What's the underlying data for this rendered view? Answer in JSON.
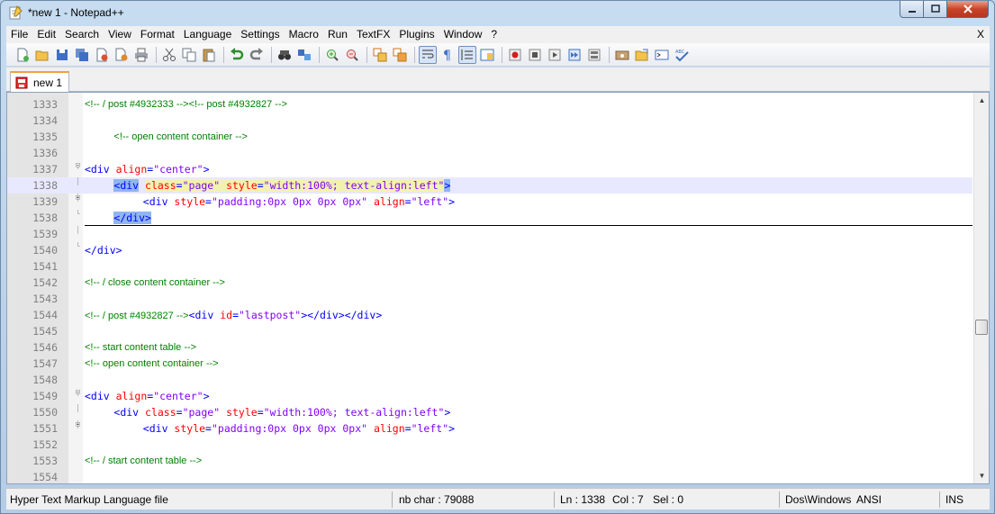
{
  "window": {
    "title": "*new 1 - Notepad++"
  },
  "menu": {
    "items": [
      "File",
      "Edit",
      "Search",
      "View",
      "Format",
      "Language",
      "Settings",
      "Macro",
      "Run",
      "TextFX",
      "Plugins",
      "Window",
      "?"
    ],
    "close_label": "X"
  },
  "tabs": [
    {
      "label": "new 1"
    }
  ],
  "editor": {
    "lines": [
      {
        "n": "1333",
        "fold": "",
        "tokens": [
          [
            "c",
            "<!-- / post #4932333 --><!-- post #4932827 -->"
          ]
        ]
      },
      {
        "n": "1334",
        "fold": "",
        "tokens": []
      },
      {
        "n": "1335",
        "fold": "",
        "indent": 4,
        "tokens": [
          [
            "c",
            "<!-- open content container -->"
          ]
        ]
      },
      {
        "n": "1336",
        "fold": "",
        "tokens": []
      },
      {
        "n": "1337",
        "fold": "minus",
        "tokens": [
          [
            "t",
            "<div "
          ],
          [
            "a",
            "align"
          ],
          [
            "t",
            "="
          ],
          [
            "v",
            "\"center\""
          ],
          [
            "t",
            ">"
          ]
        ]
      },
      {
        "n": "1338",
        "fold": "line",
        "indent": 4,
        "caret": true,
        "tokens": [
          [
            "th",
            "<div"
          ],
          [
            "t",
            " "
          ],
          [
            "ay",
            "class"
          ],
          [
            "ty",
            "="
          ],
          [
            "vy",
            "\"page\""
          ],
          [
            "ty",
            " "
          ],
          [
            "ay",
            "style"
          ],
          [
            "ty",
            "="
          ],
          [
            "vy",
            "\"width:100%; text-align:left\""
          ],
          [
            "th",
            ">"
          ]
        ]
      },
      {
        "n": "1339",
        "fold": "plus",
        "indent": 8,
        "tokens": [
          [
            "t",
            "<div "
          ],
          [
            "a",
            "style"
          ],
          [
            "t",
            "="
          ],
          [
            "v",
            "\"padding:0px 0px 0px 0px\""
          ],
          [
            "t",
            " "
          ],
          [
            "a",
            "align"
          ],
          [
            "t",
            "="
          ],
          [
            "v",
            "\"left\""
          ],
          [
            "t",
            ">"
          ]
        ]
      },
      {
        "n": "1538",
        "fold": "end",
        "indent": 4,
        "underline": true,
        "tokens": [
          [
            "th",
            "</div>"
          ]
        ]
      },
      {
        "n": "1539",
        "fold": "line",
        "tokens": []
      },
      {
        "n": "1540",
        "fold": "end",
        "tokens": [
          [
            "t",
            "</div>"
          ]
        ]
      },
      {
        "n": "1541",
        "fold": "",
        "tokens": []
      },
      {
        "n": "1542",
        "fold": "",
        "tokens": [
          [
            "c",
            "<!-- / close content container -->"
          ]
        ]
      },
      {
        "n": "1543",
        "fold": "",
        "tokens": []
      },
      {
        "n": "1544",
        "fold": "",
        "tokens": [
          [
            "c",
            "<!-- / post #4932827 -->"
          ],
          [
            "t",
            "<div "
          ],
          [
            "a",
            "id"
          ],
          [
            "t",
            "="
          ],
          [
            "v",
            "\"lastpost\""
          ],
          [
            "t",
            "></div></div>"
          ]
        ]
      },
      {
        "n": "1545",
        "fold": "",
        "tokens": []
      },
      {
        "n": "1546",
        "fold": "",
        "tokens": [
          [
            "c",
            "<!-- start content table -->"
          ]
        ]
      },
      {
        "n": "1547",
        "fold": "",
        "tokens": [
          [
            "c",
            "<!-- open content container -->"
          ]
        ]
      },
      {
        "n": "1548",
        "fold": "",
        "tokens": []
      },
      {
        "n": "1549",
        "fold": "minus",
        "tokens": [
          [
            "t",
            "<div "
          ],
          [
            "a",
            "align"
          ],
          [
            "t",
            "="
          ],
          [
            "v",
            "\"center\""
          ],
          [
            "t",
            ">"
          ]
        ]
      },
      {
        "n": "1550",
        "fold": "line",
        "indent": 4,
        "tokens": [
          [
            "t",
            "<div "
          ],
          [
            "a",
            "class"
          ],
          [
            "t",
            "="
          ],
          [
            "v",
            "\"page\""
          ],
          [
            "t",
            " "
          ],
          [
            "a",
            "style"
          ],
          [
            "t",
            "="
          ],
          [
            "v",
            "\"width:100%; text-align:left\""
          ],
          [
            "t",
            ">"
          ]
        ]
      },
      {
        "n": "1551",
        "fold": "plus",
        "indent": 8,
        "tokens": [
          [
            "t",
            "<div "
          ],
          [
            "a",
            "style"
          ],
          [
            "t",
            "="
          ],
          [
            "v",
            "\"padding:0px 0px 0px 0px\""
          ],
          [
            "t",
            " "
          ],
          [
            "a",
            "align"
          ],
          [
            "t",
            "="
          ],
          [
            "v",
            "\"left\""
          ],
          [
            "t",
            ">"
          ]
        ]
      },
      {
        "n": "1552",
        "fold": "",
        "tokens": []
      },
      {
        "n": "1553",
        "fold": "",
        "tokens": [
          [
            "c",
            "<!-- / start content table -->"
          ]
        ]
      },
      {
        "n": "1554",
        "fold": "",
        "tokens": []
      }
    ]
  },
  "status": {
    "filetype": "Hyper Text Markup Language file",
    "nbchar": "nb char : 79088",
    "ln": "Ln : 1338",
    "col": "Col : 7",
    "sel": "Sel : 0",
    "eol": "Dos\\Windows",
    "encoding": "ANSI",
    "mode": "INS"
  },
  "colors": {
    "tag": "#0000ff",
    "attribute": "#ff0000",
    "value": "#8000ff",
    "comment": "#008000",
    "selection": "#8fb6f2"
  }
}
